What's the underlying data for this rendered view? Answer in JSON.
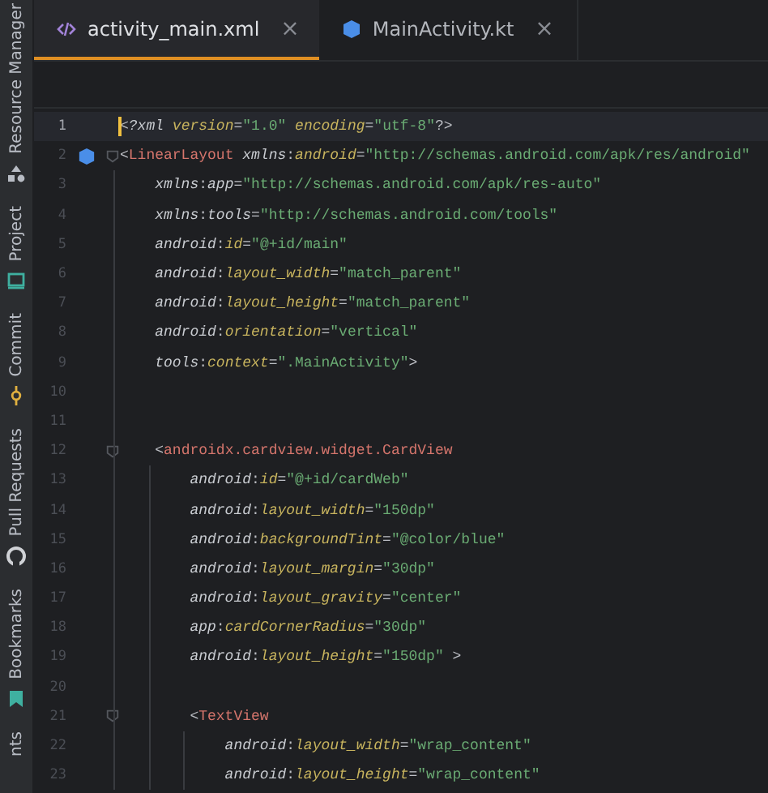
{
  "sidebar": {
    "items": [
      {
        "label": "Resource Manager",
        "kind": "resources"
      },
      {
        "label": "Project",
        "kind": "project"
      },
      {
        "label": "Commit",
        "kind": "commit"
      },
      {
        "label": "Pull Requests",
        "kind": "pulls"
      },
      {
        "label": "Bookmarks",
        "kind": "bookmarks"
      },
      {
        "label": "nts",
        "kind": "plain"
      }
    ]
  },
  "tabs": [
    {
      "label": "activity_main.xml",
      "kind": "layout",
      "close": "×",
      "selected": true
    },
    {
      "label": "MainActivity.kt",
      "kind": "kotlin",
      "close": "×",
      "selected": false
    }
  ],
  "editor": {
    "lines": [
      {
        "number": "1",
        "current": true,
        "tokens": [
          {
            "kind": "punct",
            "text": "<"
          },
          {
            "kind": "ns",
            "text": "?xml "
          },
          {
            "kind": "attr",
            "text": "version"
          },
          {
            "kind": "punct",
            "text": "="
          },
          {
            "kind": "value",
            "text": "\"1.0\" "
          },
          {
            "kind": "attr",
            "text": "encoding"
          },
          {
            "kind": "punct",
            "text": "="
          },
          {
            "kind": "value",
            "text": "\"utf-8\""
          },
          {
            "kind": "punct",
            "text": "?>"
          }
        ]
      },
      {
        "number": "2",
        "marker": true,
        "fold": true,
        "tokens": [
          {
            "kind": "punct",
            "text": "<"
          },
          {
            "kind": "tag",
            "text": "LinearLayout "
          },
          {
            "kind": "ns",
            "text": "xmlns"
          },
          {
            "kind": "punct",
            "text": ":"
          },
          {
            "kind": "attr",
            "text": "android"
          },
          {
            "kind": "punct",
            "text": "="
          },
          {
            "kind": "value",
            "text": "\"http://schemas.android.com/apk/res/android\""
          }
        ]
      },
      {
        "number": "3",
        "tokens": [
          {
            "kind": "ns",
            "text": "    xmlns"
          },
          {
            "kind": "punct",
            "text": ":"
          },
          {
            "kind": "ns",
            "text": "app"
          },
          {
            "kind": "punct",
            "text": "="
          },
          {
            "kind": "value",
            "text": "\"http://schemas.android.com/apk/res-auto\""
          }
        ]
      },
      {
        "number": "4",
        "tokens": [
          {
            "kind": "ns",
            "text": "    xmlns"
          },
          {
            "kind": "punct",
            "text": ":"
          },
          {
            "kind": "ns",
            "text": "tools"
          },
          {
            "kind": "punct",
            "text": "="
          },
          {
            "kind": "value",
            "text": "\"http://schemas.android.com/tools\""
          }
        ]
      },
      {
        "number": "5",
        "tokens": [
          {
            "kind": "ns",
            "text": "    android"
          },
          {
            "kind": "punct",
            "text": ":"
          },
          {
            "kind": "attr",
            "text": "id"
          },
          {
            "kind": "punct",
            "text": "="
          },
          {
            "kind": "value",
            "text": "\"@+id/main\""
          }
        ]
      },
      {
        "number": "6",
        "tokens": [
          {
            "kind": "ns",
            "text": "    android"
          },
          {
            "kind": "punct",
            "text": ":"
          },
          {
            "kind": "attr",
            "text": "layout_width"
          },
          {
            "kind": "punct",
            "text": "="
          },
          {
            "kind": "value",
            "text": "\"match_parent\""
          }
        ]
      },
      {
        "number": "7",
        "tokens": [
          {
            "kind": "ns",
            "text": "    android"
          },
          {
            "kind": "punct",
            "text": ":"
          },
          {
            "kind": "attr",
            "text": "layout_height"
          },
          {
            "kind": "punct",
            "text": "="
          },
          {
            "kind": "value",
            "text": "\"match_parent\""
          }
        ]
      },
      {
        "number": "8",
        "tokens": [
          {
            "kind": "ns",
            "text": "    android"
          },
          {
            "kind": "punct",
            "text": ":"
          },
          {
            "kind": "attr",
            "text": "orientation"
          },
          {
            "kind": "punct",
            "text": "="
          },
          {
            "kind": "value",
            "text": "\"vertical\""
          }
        ]
      },
      {
        "number": "9",
        "tokens": [
          {
            "kind": "ns",
            "text": "    tools"
          },
          {
            "kind": "punct",
            "text": ":"
          },
          {
            "kind": "attr",
            "text": "context"
          },
          {
            "kind": "punct",
            "text": "="
          },
          {
            "kind": "value",
            "text": "\".MainActivity\""
          },
          {
            "kind": "punct",
            "text": ">"
          }
        ]
      },
      {
        "number": "10"
      },
      {
        "number": "11"
      },
      {
        "number": "12",
        "fold": true,
        "tokens": [
          {
            "kind": "punct",
            "text": "    <"
          },
          {
            "kind": "tag",
            "text": "androidx.cardview.widget.CardView"
          }
        ]
      },
      {
        "number": "13",
        "tokens": [
          {
            "kind": "ns",
            "text": "        android"
          },
          {
            "kind": "punct",
            "text": ":"
          },
          {
            "kind": "attr",
            "text": "id"
          },
          {
            "kind": "punct",
            "text": "="
          },
          {
            "kind": "value",
            "text": "\"@+id/cardWeb\""
          }
        ]
      },
      {
        "number": "14",
        "tokens": [
          {
            "kind": "ns",
            "text": "        android"
          },
          {
            "kind": "punct",
            "text": ":"
          },
          {
            "kind": "attr",
            "text": "layout_width"
          },
          {
            "kind": "punct",
            "text": "="
          },
          {
            "kind": "value",
            "text": "\"150dp\""
          }
        ]
      },
      {
        "number": "15",
        "tokens": [
          {
            "kind": "ns",
            "text": "        android"
          },
          {
            "kind": "punct",
            "text": ":"
          },
          {
            "kind": "attr",
            "text": "backgroundTint"
          },
          {
            "kind": "punct",
            "text": "="
          },
          {
            "kind": "value",
            "text": "\"@color/blue\""
          }
        ]
      },
      {
        "number": "16",
        "tokens": [
          {
            "kind": "ns",
            "text": "        android"
          },
          {
            "kind": "punct",
            "text": ":"
          },
          {
            "kind": "attr",
            "text": "layout_margin"
          },
          {
            "kind": "punct",
            "text": "="
          },
          {
            "kind": "value",
            "text": "\"30dp\""
          }
        ]
      },
      {
        "number": "17",
        "tokens": [
          {
            "kind": "ns",
            "text": "        android"
          },
          {
            "kind": "punct",
            "text": ":"
          },
          {
            "kind": "attr",
            "text": "layout_gravity"
          },
          {
            "kind": "punct",
            "text": "="
          },
          {
            "kind": "value",
            "text": "\"center\""
          }
        ]
      },
      {
        "number": "18",
        "tokens": [
          {
            "kind": "ns",
            "text": "        app"
          },
          {
            "kind": "punct",
            "text": ":"
          },
          {
            "kind": "attr",
            "text": "cardCornerRadius"
          },
          {
            "kind": "punct",
            "text": "="
          },
          {
            "kind": "value",
            "text": "\"30dp\""
          }
        ]
      },
      {
        "number": "19",
        "tokens": [
          {
            "kind": "ns",
            "text": "        android"
          },
          {
            "kind": "punct",
            "text": ":"
          },
          {
            "kind": "attr",
            "text": "layout_height"
          },
          {
            "kind": "punct",
            "text": "="
          },
          {
            "kind": "value",
            "text": "\"150dp\" "
          },
          {
            "kind": "punct",
            "text": ">"
          }
        ]
      },
      {
        "number": "20"
      },
      {
        "number": "21",
        "fold": true,
        "tokens": [
          {
            "kind": "punct",
            "text": "        <"
          },
          {
            "kind": "tag",
            "text": "TextView"
          }
        ]
      },
      {
        "number": "22",
        "tokens": [
          {
            "kind": "ns",
            "text": "            android"
          },
          {
            "kind": "punct",
            "text": ":"
          },
          {
            "kind": "attr",
            "text": "layout_width"
          },
          {
            "kind": "punct",
            "text": "="
          },
          {
            "kind": "value",
            "text": "\"wrap_content\""
          }
        ]
      },
      {
        "number": "23",
        "tokens": [
          {
            "kind": "ns",
            "text": "            android"
          },
          {
            "kind": "punct",
            "text": ":"
          },
          {
            "kind": "attr",
            "text": "layout_height"
          },
          {
            "kind": "punct",
            "text": "="
          },
          {
            "kind": "value",
            "text": "\"wrap_content\""
          }
        ]
      }
    ]
  }
}
